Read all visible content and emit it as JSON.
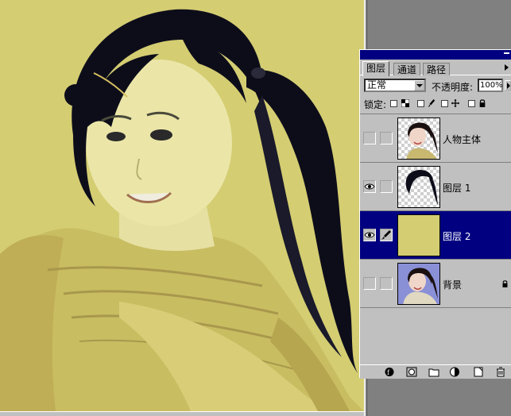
{
  "panel": {
    "tabs": [
      {
        "label": "图层",
        "active": true
      },
      {
        "label": "通道",
        "active": false
      },
      {
        "label": "路径",
        "active": false
      }
    ],
    "blend_mode": "正常",
    "opacity_label": "不透明度:",
    "opacity_value": "100%",
    "lock_label": "锁定:",
    "layers": [
      {
        "name": "人物主体",
        "visible": false,
        "selected": false
      },
      {
        "name": "图层 1",
        "visible": true,
        "selected": false
      },
      {
        "name": "图层 2",
        "visible": true,
        "selected": true
      },
      {
        "name": "背景",
        "visible": false,
        "selected": false,
        "locked": true
      }
    ]
  },
  "colors": {
    "canvas_bg": "#d4cd72",
    "selection": "#000080",
    "panel_bg": "#c0c0c0",
    "hair": "#0d0d1a"
  },
  "icons": {
    "eye": "eye-icon",
    "brush": "brush-icon",
    "lock": "lock-icon",
    "trash": "trash-icon"
  }
}
